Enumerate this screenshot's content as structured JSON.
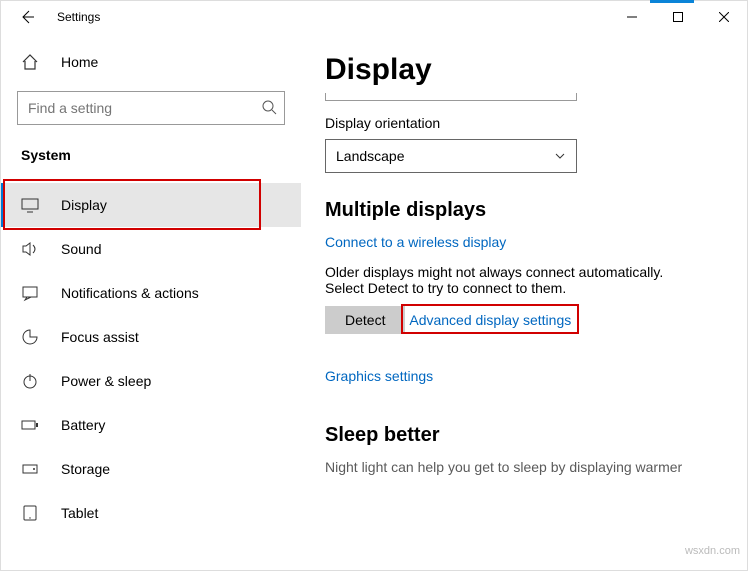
{
  "titlebar": {
    "title": "Settings"
  },
  "sidebar": {
    "home_label": "Home",
    "search_placeholder": "Find a setting",
    "category_label": "System",
    "items": [
      {
        "icon": "display",
        "label": "Display",
        "active": true
      },
      {
        "icon": "sound",
        "label": "Sound"
      },
      {
        "icon": "notifications",
        "label": "Notifications & actions"
      },
      {
        "icon": "focus",
        "label": "Focus assist"
      },
      {
        "icon": "power",
        "label": "Power & sleep"
      },
      {
        "icon": "battery",
        "label": "Battery"
      },
      {
        "icon": "storage",
        "label": "Storage"
      },
      {
        "icon": "tablet",
        "label": "Tablet"
      }
    ]
  },
  "content": {
    "page_title": "Display",
    "orientation_label": "Display orientation",
    "orientation_value": "Landscape",
    "multiple_displays_heading": "Multiple displays",
    "connect_wireless_link": "Connect to a wireless display",
    "older_displays_text": "Older displays might not always connect automatically. Select Detect to try to connect to them.",
    "detect_button": "Detect",
    "advanced_link": "Advanced display settings",
    "graphics_link": "Graphics settings",
    "sleep_heading": "Sleep better",
    "sleep_text": "Night light can help you get to sleep by displaying warmer"
  },
  "watermark": "wsxdn.com"
}
